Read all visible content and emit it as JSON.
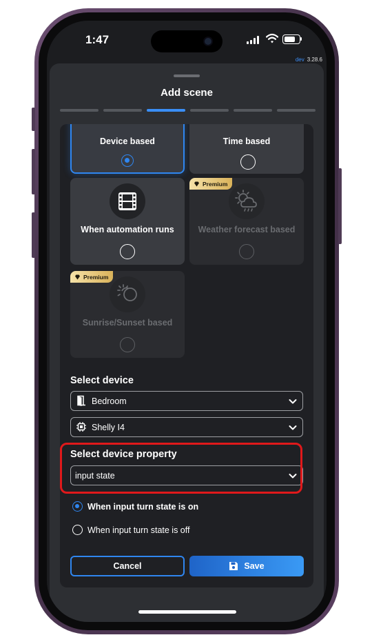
{
  "status_bar": {
    "time": "1:47",
    "env_label": "dev",
    "version": "3.28.6",
    "icons": [
      "signal-icon",
      "wifi-icon",
      "battery-icon"
    ]
  },
  "sheet": {
    "title": "Add scene",
    "steps_total": 6,
    "active_step": 3
  },
  "scene_types": [
    {
      "label": "Device based",
      "selected": true,
      "premium": false,
      "enabled": true
    },
    {
      "label": "Time based",
      "selected": false,
      "premium": false,
      "enabled": true
    },
    {
      "label": "When automation runs",
      "selected": false,
      "premium": false,
      "enabled": true,
      "icon": "film-icon"
    },
    {
      "label": "Weather forecast based",
      "selected": false,
      "premium": true,
      "enabled": false,
      "icon": "weather-icon"
    },
    {
      "label": "Sunrise/Sunset based",
      "selected": false,
      "premium": true,
      "enabled": false,
      "icon": "sunrise-sunset-icon"
    }
  ],
  "premium_badge": "Premium",
  "device_section": {
    "title": "Select device",
    "room": {
      "value": "Bedroom",
      "icon": "door-icon"
    },
    "device": {
      "value": "Shelly I4",
      "icon": "chip-icon"
    }
  },
  "property_section": {
    "title": "Select device property",
    "value": "input state"
  },
  "state_options": [
    {
      "label": "When input turn state is on",
      "selected": true
    },
    {
      "label": "When input turn state is off",
      "selected": false
    }
  ],
  "buttons": {
    "cancel": "Cancel",
    "save": "Save"
  },
  "colors": {
    "accent": "#2f86f0",
    "highlight": "#e0191b",
    "premium_gold": "#d9b25a"
  }
}
